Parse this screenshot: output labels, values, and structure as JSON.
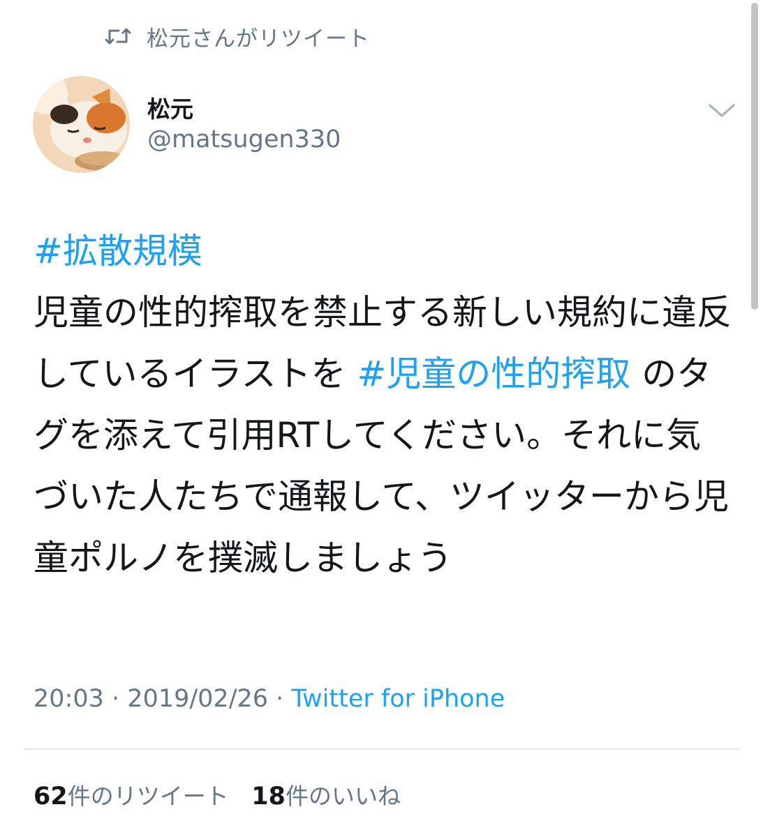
{
  "retweet_banner": {
    "icon": "retweet-icon",
    "text": "松元さんがリツイート"
  },
  "author": {
    "avatar": "cat-avatar",
    "display_name": "松元",
    "handle": "@matsugen330"
  },
  "menu": {
    "icon": "chevron-down-icon"
  },
  "tweet": {
    "hashtag_1": "#拡散規模",
    "text_1": "児童の性的搾取を禁止する新しい規約に違反しているイラストを ",
    "hashtag_2": "#児童の性的搾取",
    "text_2": " のタグを添えて引用RTしてください。それに気づいた人たちで通報して、ツイッターから児童ポルノを撲滅しましょう"
  },
  "meta": {
    "time": "20:03",
    "separator": "·",
    "date": "2019/02/26",
    "source": "Twitter for iPhone"
  },
  "stats": {
    "retweets_count": "62",
    "retweets_label": "件のリツイート",
    "likes_count": "18",
    "likes_label": "件のいいね"
  },
  "colors": {
    "link": "#1da1f2",
    "secondary": "#657786",
    "text": "#14171a",
    "divider": "#e1e8ed"
  }
}
